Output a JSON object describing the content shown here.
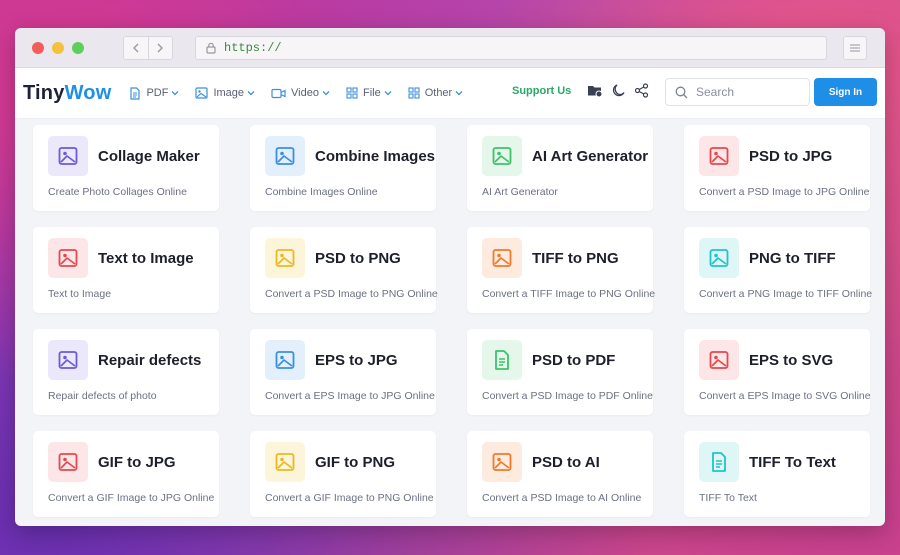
{
  "browser": {
    "url": "https://",
    "back_icon": "chevron-left-icon",
    "forward_icon": "chevron-right-icon",
    "menu_icon": "hamburger-menu-icon"
  },
  "header": {
    "logo_part1": "Tiny",
    "logo_part2": "Wow",
    "nav": [
      {
        "label": "PDF",
        "icon": "document-icon"
      },
      {
        "label": "Image",
        "icon": "image-icon"
      },
      {
        "label": "Video",
        "icon": "video-camera-icon"
      },
      {
        "label": "File",
        "icon": "grid-icon"
      },
      {
        "label": "Other",
        "icon": "grid-icon"
      }
    ],
    "support_label": "Support Us",
    "search_placeholder": "Search",
    "signin_label": "Sign In"
  },
  "colors": {
    "brand_blue": "#1e8ee6",
    "support_green": "#28a86a",
    "purple": "#6b5bd6",
    "blue": "#3b8fe0",
    "green": "#3cc26a",
    "red": "#e5484d",
    "yellow": "#e9b824",
    "orange": "#ef7a2a",
    "teal": "#20c3c8"
  },
  "tools": [
    {
      "title": "Collage Maker",
      "desc": "Create Photo Collages Online",
      "color": "purple",
      "icon": "image-icon"
    },
    {
      "title": "Combine Images",
      "desc": "Combine Images Online",
      "color": "blue",
      "icon": "image-icon"
    },
    {
      "title": "AI Art Generator",
      "desc": "AI Art Generator",
      "color": "green",
      "icon": "image-icon"
    },
    {
      "title": "PSD to JPG",
      "desc": "Convert a PSD Image to JPG Online",
      "color": "red",
      "icon": "image-icon"
    },
    {
      "title": "Text to Image",
      "desc": "Text to Image",
      "color": "red",
      "icon": "image-icon"
    },
    {
      "title": "PSD to PNG",
      "desc": "Convert a PSD Image to PNG Online",
      "color": "yellow",
      "icon": "image-icon"
    },
    {
      "title": "TIFF to PNG",
      "desc": "Convert a TIFF Image to PNG Online",
      "color": "orange",
      "icon": "image-icon"
    },
    {
      "title": "PNG to TIFF",
      "desc": "Convert a PNG Image to TIFF Online",
      "color": "teal",
      "icon": "image-icon"
    },
    {
      "title": "Repair defects",
      "desc": "Repair defects of photo",
      "color": "purple",
      "icon": "image-icon"
    },
    {
      "title": "EPS to JPG",
      "desc": "Convert a EPS Image to JPG Online",
      "color": "blue",
      "icon": "image-icon"
    },
    {
      "title": "PSD to PDF",
      "desc": "Convert a PSD Image to PDF Online",
      "color": "green",
      "icon": "document-icon"
    },
    {
      "title": "EPS to SVG",
      "desc": "Convert a EPS Image to SVG Online",
      "color": "red",
      "icon": "image-icon"
    },
    {
      "title": "GIF to JPG",
      "desc": "Convert a GIF Image to JPG Online",
      "color": "red",
      "icon": "image-icon"
    },
    {
      "title": "GIF to PNG",
      "desc": "Convert a GIF Image to PNG Online",
      "color": "yellow",
      "icon": "image-icon"
    },
    {
      "title": "PSD to AI",
      "desc": "Convert a PSD Image to AI Online",
      "color": "orange",
      "icon": "image-icon"
    },
    {
      "title": "TIFF To Text",
      "desc": "TIFF To Text",
      "color": "teal",
      "icon": "document-icon"
    }
  ]
}
